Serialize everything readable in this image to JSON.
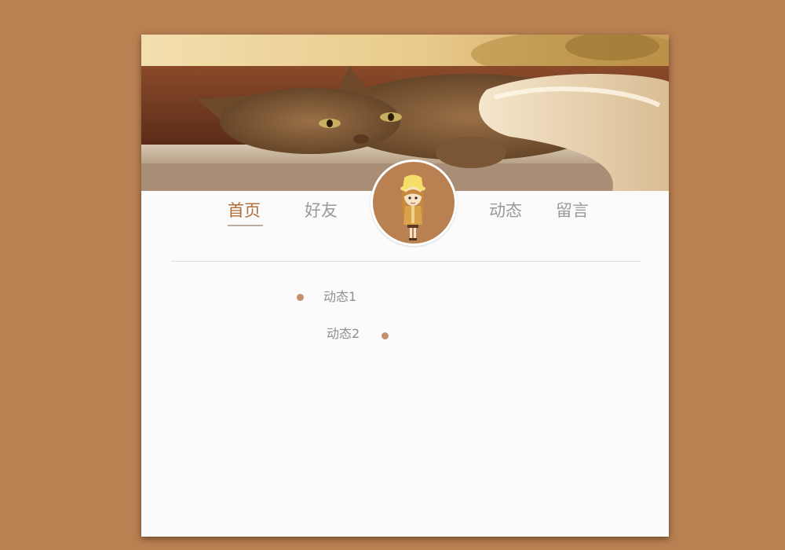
{
  "nav": {
    "items": [
      {
        "label": "首页",
        "active": true
      },
      {
        "label": "好友",
        "active": false
      },
      {
        "label": "动态",
        "active": false
      },
      {
        "label": "留言",
        "active": false
      }
    ]
  },
  "banner": {
    "image": "cat-on-ledge-photo"
  },
  "avatar": {
    "image": "girl-yellow-hat-illustration"
  },
  "feed": {
    "items": [
      {
        "label": "动态1",
        "side": "right"
      },
      {
        "label": "动态2",
        "side": "left"
      }
    ]
  },
  "colors": {
    "page_background": "#b98152",
    "card_background": "#fbfbfb",
    "active_nav": "#b06d3a",
    "inactive_nav": "#9a9a9a",
    "timeline_dot": "#c4906b"
  }
}
